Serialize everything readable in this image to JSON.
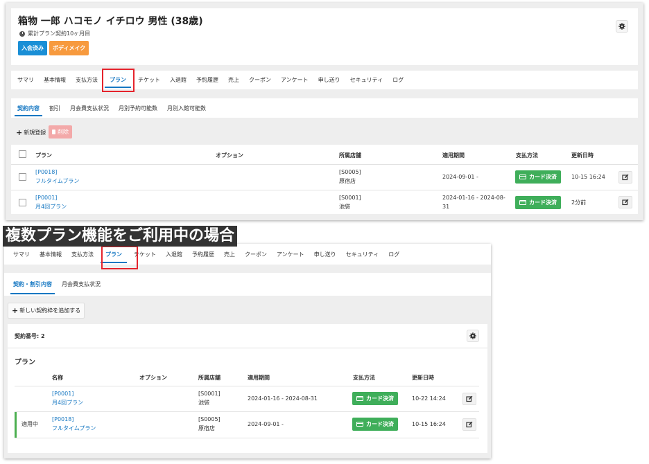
{
  "member": {
    "name": "箱物 一郎 ハコモノ イチロウ 男性 (38歳)",
    "contract_months": "累計プラン契約10ヶ月目",
    "badges": [
      {
        "label": "入会済み",
        "color": "#1a8fd6"
      },
      {
        "label": "ボディメイク",
        "color": "#f79a3e"
      }
    ]
  },
  "main_tabs": [
    "サマリ",
    "基本情報",
    "支払方法",
    "プラン",
    "チケット",
    "入退館",
    "予約履歴",
    "売上",
    "クーポン",
    "アンケート",
    "申し送り",
    "セキュリティ",
    "ログ"
  ],
  "active_main_tab": "プラン",
  "sub_tabs_1": [
    "契約内容",
    "割引",
    "月会費支払状況",
    "月別予約可能数",
    "月別入館可能数"
  ],
  "toolbar_1": {
    "add_label": "新規登録",
    "delete_label": "削除"
  },
  "table_1": {
    "headers": [
      "プラン",
      "オプション",
      "所属店舗",
      "適用期間",
      "支払方法",
      "更新日時"
    ],
    "rows": [
      {
        "code": "[P0018]",
        "plan": "フルタイムプラン",
        "store_code": "[S0005]",
        "store": "原宿店",
        "period": "2024-09-01 -",
        "period2": "",
        "payment": "カード決済",
        "updated": "10-15 16:24"
      },
      {
        "code": "[P0001]",
        "plan": "月4回プラン",
        "store_code": "[S0001]",
        "store": "池袋",
        "period": "2024-01-16 - 2024-08-",
        "period2": "31",
        "payment": "カード決済",
        "updated": "2分前"
      }
    ]
  },
  "caption": "複数プラン機能をご利用中の場合",
  "sub_tabs_2": [
    "契約・割引内容",
    "月会費支払状況"
  ],
  "toolbar_2": {
    "add_label": "新しい契約枠を追加する"
  },
  "contract": {
    "number_label": "契約番号: 2",
    "section_title": "プラン"
  },
  "table_2": {
    "headers": [
      "名称",
      "オプション",
      "所属店舗",
      "適用期間",
      "支払方法",
      "更新日時"
    ],
    "rows": [
      {
        "status": "",
        "code": "[P0001]",
        "plan": "月4回プラン",
        "store_code": "[S0001]",
        "store": "池袋",
        "period": "2024-01-16 - 2024-08-31",
        "payment": "カード決済",
        "updated": "10-22 14:24"
      },
      {
        "status": "適用中",
        "code": "[P0018]",
        "plan": "フルタイムプラン",
        "store_code": "[S0005]",
        "store": "原宿店",
        "period": "2024-09-01 -",
        "payment": "カード決済",
        "updated": "10-15 16:24"
      }
    ]
  },
  "colors": {
    "accent": "#1577c2",
    "highlight": "#e5232c",
    "payment": "#3fae5a",
    "active_bar": "#4caf50"
  },
  "icons": {
    "gear": "gear-icon",
    "clock": "clock-icon",
    "plus": "plus-icon",
    "trash": "trash-icon",
    "card": "card-icon",
    "edit": "edit-icon"
  }
}
